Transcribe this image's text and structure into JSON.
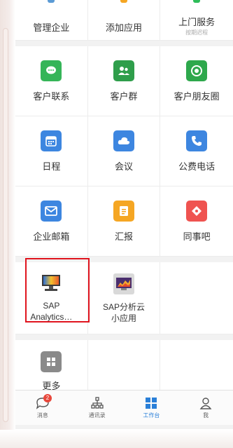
{
  "top_row": [
    {
      "label": "管理企业",
      "mark_color": "#5b9bd5"
    },
    {
      "label": "添加应用",
      "mark_color": "#f5a623"
    },
    {
      "label": "上门服务",
      "sub": "按期迟程",
      "mark_color": "#2ebd59"
    }
  ],
  "grid": [
    {
      "label": "客户联系",
      "icon": "chat-bubble-icon",
      "color": "#35b558",
      "glyph": "●"
    },
    {
      "label": "客户群",
      "icon": "group-icon",
      "color": "#2f9e4b",
      "glyph": "人"
    },
    {
      "label": "客户朋友圈",
      "icon": "camera-shutter-icon",
      "color": "#2ea84c",
      "glyph": "✿"
    },
    {
      "label": "日程",
      "icon": "calendar-icon",
      "color": "#3d86e0",
      "glyph": "▦"
    },
    {
      "label": "会议",
      "icon": "cloud-icon",
      "color": "#3d86e0",
      "glyph": "☁"
    },
    {
      "label": "公费电话",
      "icon": "phone-icon",
      "color": "#3d86e0",
      "glyph": "✆"
    },
    {
      "label": "企业邮箱",
      "icon": "mail-icon",
      "color": "#3d86e0",
      "glyph": "✉"
    },
    {
      "label": "汇报",
      "icon": "report-icon",
      "color": "#f5a623",
      "glyph": "≡"
    },
    {
      "label": "同事吧",
      "icon": "diamond-icon",
      "color": "#ef5350",
      "glyph": "◆"
    }
  ],
  "apps": [
    {
      "label_line1": "SAP",
      "label_line2": "Analytics…",
      "icon": "sap-analytics-monitor-icon"
    },
    {
      "label_line1": "SAP分析云",
      "label_line2": "小应用",
      "icon": "sap-analytics-cloud-chart-icon"
    }
  ],
  "more": {
    "label": "更多",
    "icon": "more-grid-icon"
  },
  "tabbar": [
    {
      "label": "消息",
      "icon": "message-icon",
      "badge": "2",
      "active": false
    },
    {
      "label": "通讯录",
      "icon": "org-chart-icon",
      "active": false
    },
    {
      "label": "工作台",
      "icon": "workbench-grid-icon",
      "active": true
    },
    {
      "label": "我",
      "icon": "person-icon",
      "active": false
    }
  ],
  "colors": {
    "highlight": "#e0141e",
    "active_tab": "#2a7fd8"
  }
}
